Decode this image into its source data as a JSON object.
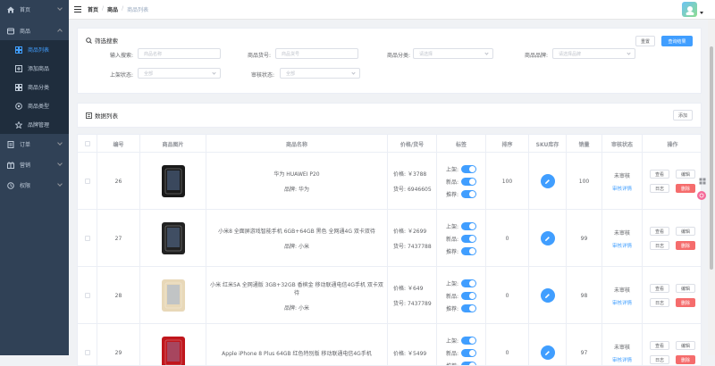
{
  "sidebar": {
    "home": "首页",
    "product": "商品",
    "sub": [
      "商品列表",
      "添加商品",
      "商品分类",
      "商品类型",
      "品牌管理"
    ],
    "order": "订单",
    "marketing": "营销",
    "permission": "权限"
  },
  "navbar": {
    "crumb_home": "首页",
    "crumb_product": "商品",
    "crumb_current": "商品列表"
  },
  "filter": {
    "title": "筛选搜索",
    "reset_label": "重置",
    "query_label": "查询结果",
    "keyword_label": "输入搜索:",
    "keyword_placeholder": "商品名称",
    "sn_label": "商品货号:",
    "sn_placeholder": "商品货号",
    "category_label": "商品分类:",
    "category_placeholder": "请选择",
    "brand_label": "商品品牌:",
    "brand_placeholder": "请选择品牌",
    "publish_label": "上架状态:",
    "publish_placeholder": "全部",
    "verify_label": "审核状态:",
    "verify_placeholder": "全部"
  },
  "list": {
    "title": "数据列表",
    "add_label": "添加"
  },
  "table": {
    "headers": [
      "编号",
      "商品图片",
      "商品名称",
      "价格/货号",
      "标签",
      "排序",
      "SKU库存",
      "销量",
      "审核状态",
      "操作"
    ],
    "price_prefix": "价格: ",
    "sn_prefix": "货号: ",
    "brand_prefix": "品牌: ",
    "tag_publish": "上架:",
    "tag_new": "新品:",
    "tag_recommend": "推荐:",
    "view_label": "查看",
    "edit_label": "编辑",
    "log_label": "日志",
    "delete_label": "删除",
    "audit_link": "审核详情",
    "rows": [
      {
        "id": "26",
        "name": "华为 HUAWEI P20",
        "brand": "华为",
        "price": "￥3788",
        "sn": "6946605",
        "sort": "100",
        "sales": "100",
        "status": "未审核",
        "color": "#1a1a1a",
        "hasBrand": true
      },
      {
        "id": "27",
        "name": "小米8 全面屏游戏智能手机 6GB+64GB 黑色 全网通4G 双卡双待",
        "brand": "小米",
        "price": "￥2699",
        "sn": "7437788",
        "sort": "0",
        "sales": "99",
        "status": "未审核",
        "color": "#222222",
        "hasBrand": true
      },
      {
        "id": "28",
        "name": "小米 红米5A 全网通版 3GB+32GB 香槟金 移动联通电信4G手机 双卡双待",
        "brand": "小米",
        "price": "￥649",
        "sn": "7437789",
        "sort": "0",
        "sales": "98",
        "status": "未审核",
        "color": "#e8d8b8",
        "hasBrand": true
      },
      {
        "id": "29",
        "name": "Apple iPhone 8 Plus 64GB 红色特别版 移动联通电信4G手机",
        "brand": "",
        "price": "￥5499",
        "sn": "",
        "sort": "0",
        "sales": "97",
        "status": "未审核",
        "color": "#c0161c",
        "hasBrand": false
      }
    ]
  }
}
